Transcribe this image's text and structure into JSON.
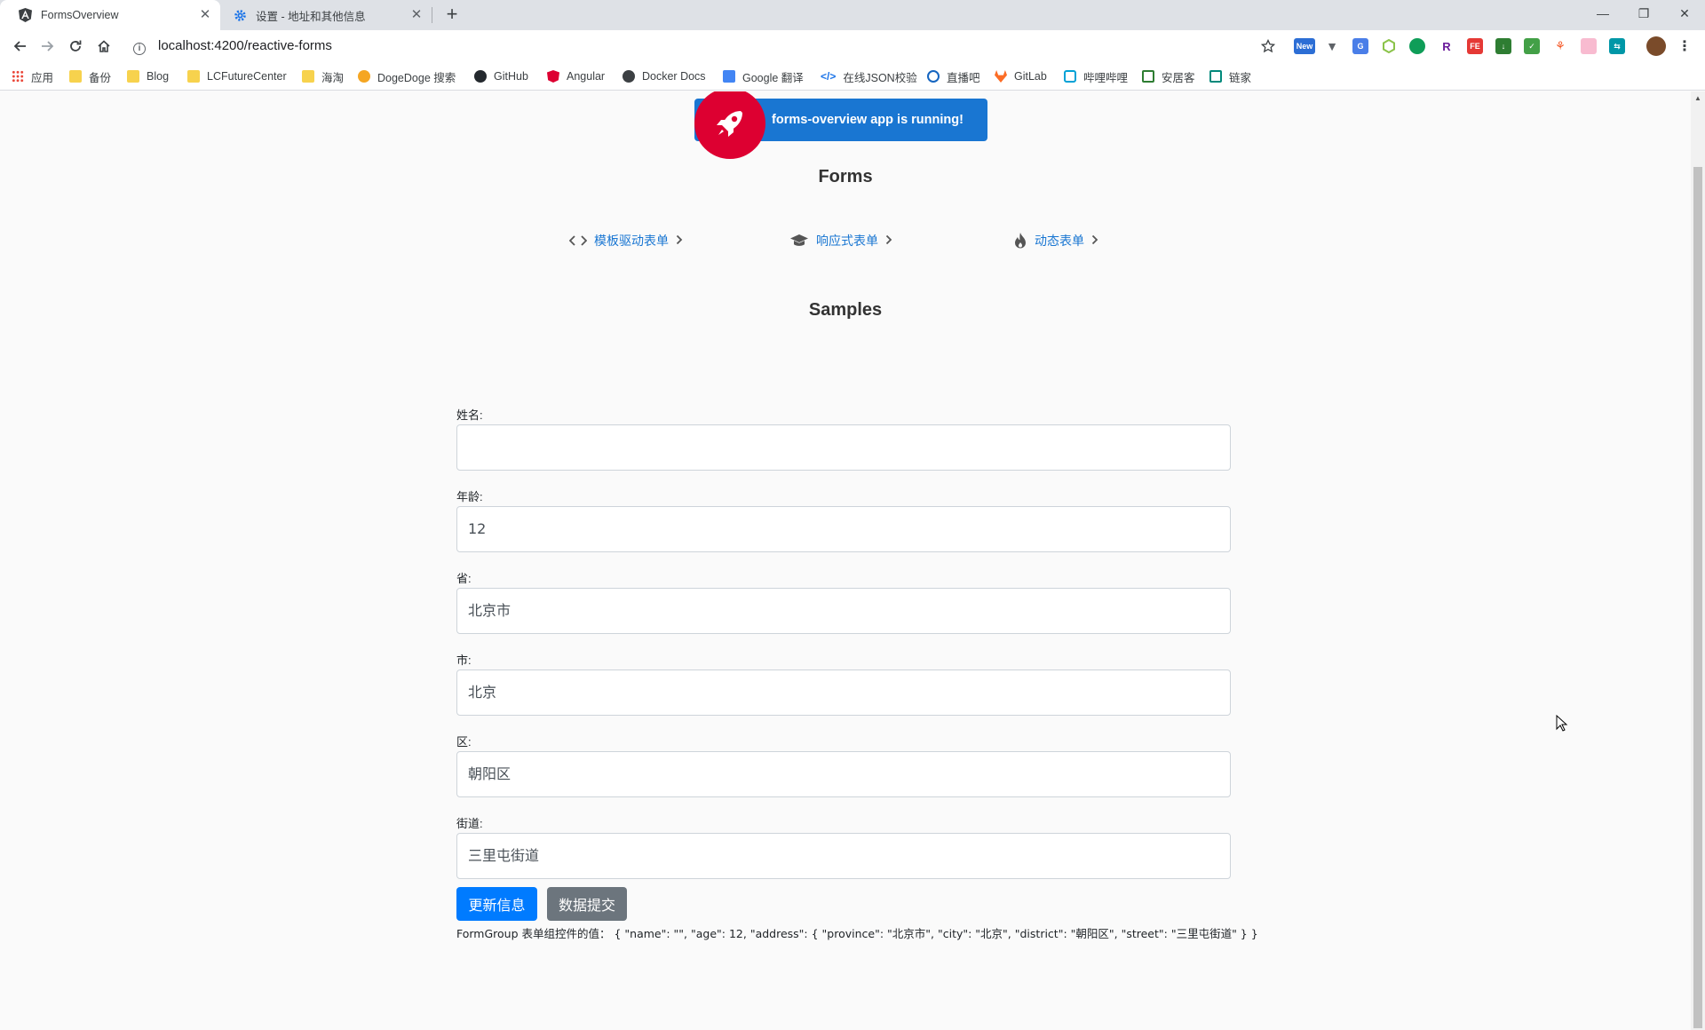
{
  "browser": {
    "tabs": [
      {
        "title": "FormsOverview",
        "icon": "angular-icon",
        "active": true
      },
      {
        "title": "设置 - 地址和其他信息",
        "icon": "gear-icon",
        "active": false
      }
    ],
    "new_tab_icon": "+",
    "url": "localhost:4200/reactive-forms",
    "bookmarks": [
      {
        "label": "应用",
        "icon": "apps-grid-icon"
      },
      {
        "label": "备份",
        "icon": "folder-icon"
      },
      {
        "label": "Blog",
        "icon": "folder-icon"
      },
      {
        "label": "LCFutureCenter",
        "icon": "folder-icon"
      },
      {
        "label": "海淘",
        "icon": "folder-icon"
      },
      {
        "label": "DogeDoge 搜索",
        "icon": "dogedoge-icon"
      },
      {
        "label": "GitHub",
        "icon": "github-icon"
      },
      {
        "label": "Angular",
        "icon": "angular-icon"
      },
      {
        "label": "Docker Docs",
        "icon": "docker-icon"
      },
      {
        "label": "Google 翻译",
        "icon": "google-translate-icon"
      },
      {
        "label": "在线JSON校验",
        "icon": "json-icon"
      },
      {
        "label": "直播吧",
        "icon": "zhibo8-icon"
      },
      {
        "label": "GitLab",
        "icon": "gitlab-icon"
      },
      {
        "label": "哔哩哔哩",
        "icon": "bilibili-icon"
      },
      {
        "label": "安居客",
        "icon": "anjuke-icon"
      },
      {
        "label": "链家",
        "icon": "lianjia-icon"
      }
    ],
    "extension_new_badge": "New"
  },
  "page": {
    "banner_text": "forms-overview app is running!",
    "forms_heading": "Forms",
    "links": [
      {
        "label": "模板驱动表单",
        "icon": "code-brackets-icon"
      },
      {
        "label": "响应式表单",
        "icon": "graduation-cap-icon"
      },
      {
        "label": "动态表单",
        "icon": "fire-icon"
      }
    ],
    "samples_heading": "Samples",
    "form": {
      "fields": [
        {
          "label": "姓名:",
          "value": ""
        },
        {
          "label": "年龄:",
          "value": "12"
        },
        {
          "label": "省:",
          "value": "北京市"
        },
        {
          "label": "市:",
          "value": "北京"
        },
        {
          "label": "区:",
          "value": "朝阳区"
        },
        {
          "label": "街道:",
          "value": "三里屯街道"
        }
      ],
      "update_button": "更新信息",
      "submit_button": "数据提交",
      "formgroup_value": "FormGroup 表单组控件的值： { \"name\": \"\", \"age\": 12, \"address\": { \"province\": \"北京市\", \"city\": \"北京\", \"district\": \"朝阳区\", \"street\": \"三里屯街道\" } }"
    }
  },
  "colors": {
    "angular_red": "#dd0031",
    "banner_blue": "#1976d2",
    "primary": "#007bff",
    "secondary": "#6c757d"
  }
}
